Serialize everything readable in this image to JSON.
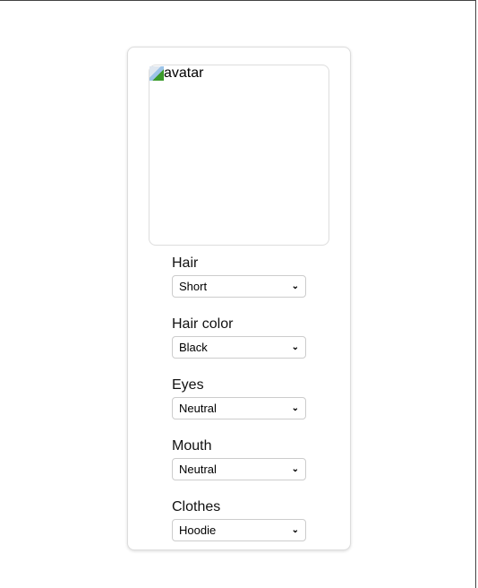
{
  "avatar": {
    "alt": "avatar"
  },
  "fields": [
    {
      "label": "Hair",
      "value": "Short"
    },
    {
      "label": "Hair color",
      "value": "Black"
    },
    {
      "label": "Eyes",
      "value": "Neutral"
    },
    {
      "label": "Mouth",
      "value": "Neutral"
    },
    {
      "label": "Clothes",
      "value": "Hoodie"
    }
  ]
}
